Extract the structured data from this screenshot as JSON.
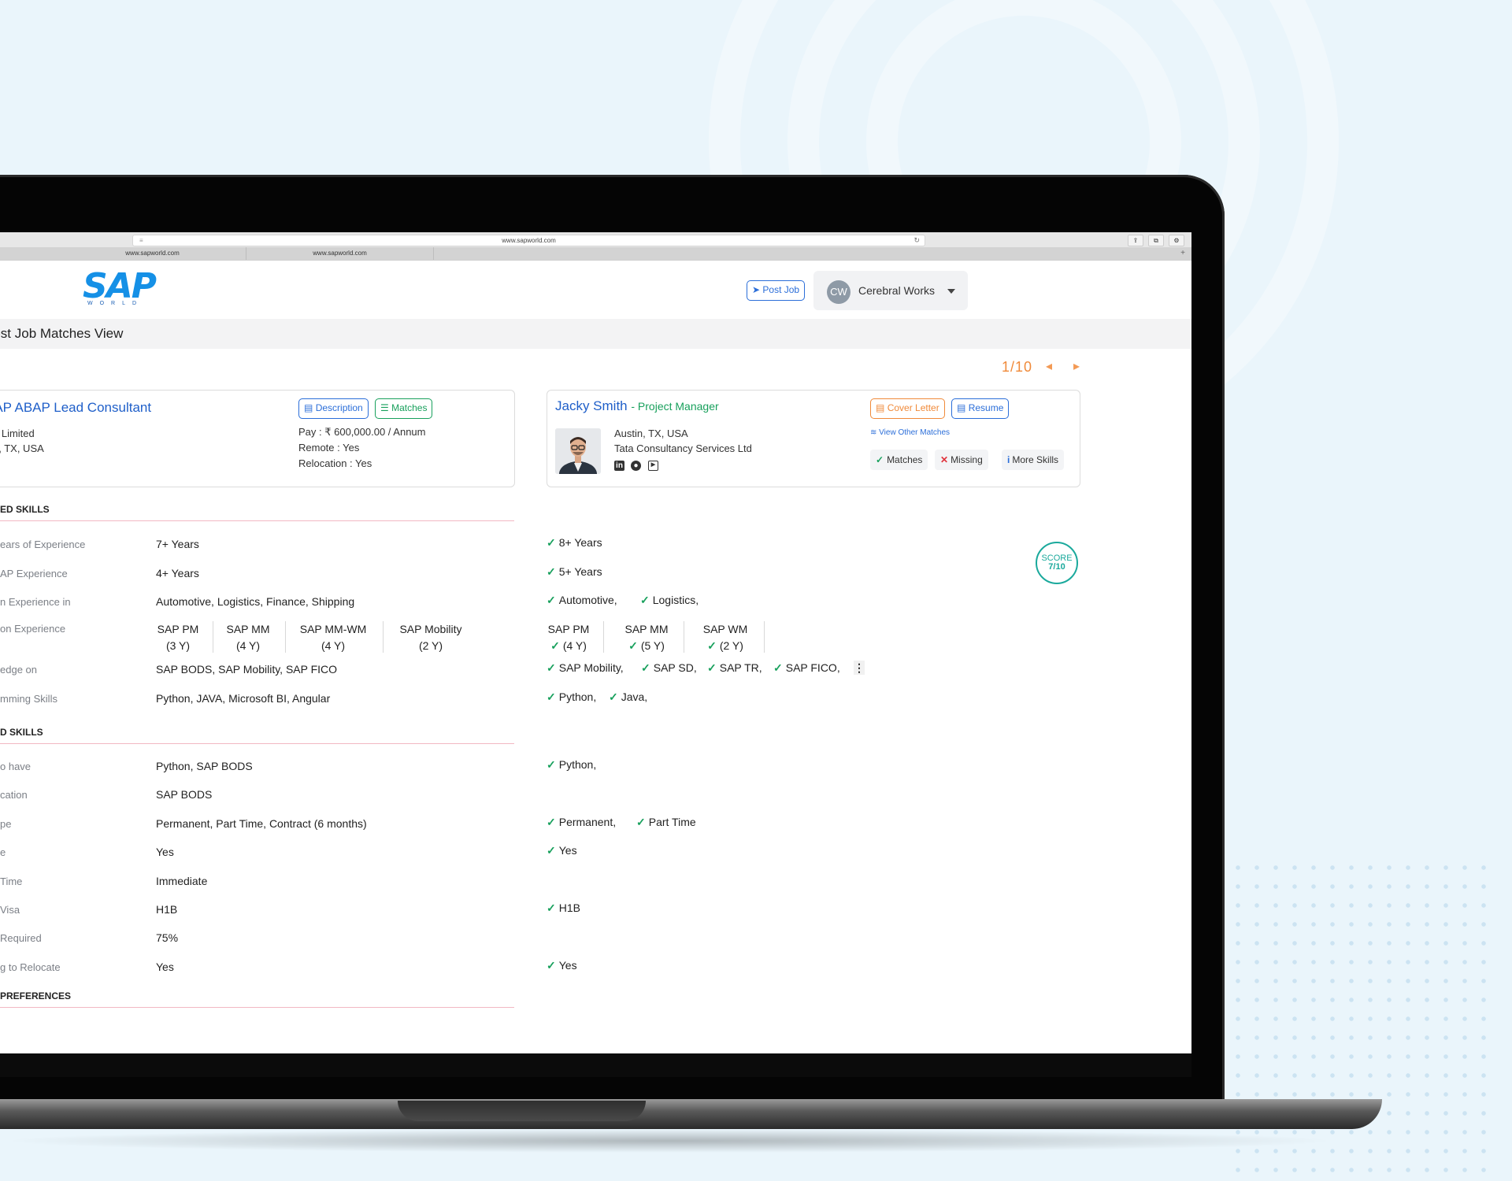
{
  "browser": {
    "url": "www.sapworld.com",
    "tabs": [
      "www.sapworld.com",
      "www.sapworld.com"
    ]
  },
  "header": {
    "logo_text": "SAP",
    "logo_sub": "WORLD",
    "post_job": "Post Job",
    "account_initials": "CW",
    "account_name": "Cerebral Works"
  },
  "page": {
    "title": "Post Job Matches View",
    "pager": "1/10"
  },
  "job": {
    "title": "SAP ABAP Lead Consultant",
    "company": "o Limited",
    "location": "n, TX, USA",
    "description_btn": "Description",
    "matches_btn": "Matches",
    "pay": "Pay : ₹ 600,000.00 / Annum",
    "remote": "Remote : Yes",
    "relocation": "Relocation : Yes"
  },
  "candidate": {
    "name": "Jacky Smith",
    "role": "- Project Manager",
    "location": "Austin, TX, USA",
    "company": "Tata Consultancy Services Ltd",
    "cover_letter_btn": "Cover Letter",
    "resume_btn": "Resume",
    "view_other": "View Other Matches",
    "chips": [
      "Matches",
      "Missing",
      "More Skills"
    ]
  },
  "score": {
    "label": "SCORE",
    "value": "7/10"
  },
  "sections": {
    "required": "ED SKILLS",
    "desired": "D SKILLS",
    "preferences": "PREFERENCES"
  },
  "required_rows": [
    {
      "label": "ears of Experience",
      "value": "7+ Years",
      "match": [
        "8+ Years"
      ]
    },
    {
      "label": "AP Experience",
      "value": "4+ Years",
      "match": [
        "5+ Years"
      ]
    },
    {
      "label": "n Experience in",
      "value": "Automotive, Logistics, Finance, Shipping",
      "match": [
        "Automotive,",
        "Logistics,"
      ]
    },
    {
      "label": "on Experience",
      "value": "",
      "match": []
    },
    {
      "label": "edge on",
      "value": "SAP BODS, SAP Mobility, SAP FICO",
      "match": [
        "SAP Mobility,",
        "SAP SD,",
        "SAP TR,",
        "SAP FICO,"
      ]
    },
    {
      "label": "mming Skills",
      "value": "Python, JAVA, Microsoft BI, Angular",
      "match": [
        "Python,",
        "Java,"
      ]
    }
  ],
  "modules_required": [
    {
      "name": "SAP PM",
      "years": "(3 Y)"
    },
    {
      "name": "SAP MM",
      "years": "(4 Y)"
    },
    {
      "name": "SAP MM-WM",
      "years": "(4 Y)"
    },
    {
      "name": "SAP Mobility",
      "years": "(2 Y)"
    }
  ],
  "modules_candidate": [
    {
      "name": "SAP PM",
      "years": "(4 Y)"
    },
    {
      "name": "SAP MM",
      "years": "(5 Y)"
    },
    {
      "name": "SAP WM",
      "years": "(2 Y)"
    }
  ],
  "desired_rows": [
    {
      "label": "o have",
      "value": "Python, SAP BODS",
      "match": [
        "Python,"
      ]
    },
    {
      "label": "cation",
      "value": "SAP BODS",
      "match": []
    },
    {
      "label": "pe",
      "value": "Permanent, Part Time, Contract (6 months)",
      "match": [
        "Permanent,",
        "Part Time"
      ]
    },
    {
      "label": "e",
      "value": "Yes",
      "match": [
        "Yes"
      ]
    },
    {
      "label": "Time",
      "value": "Immediate",
      "match": []
    },
    {
      "label": "Visa",
      "value": "H1B",
      "match": [
        "H1B"
      ]
    },
    {
      "label": "Required",
      "value": "75%",
      "match": []
    },
    {
      "label": "g to Relocate",
      "value": "Yes",
      "match": [
        "Yes"
      ]
    }
  ],
  "colors": {
    "brand": "#1590e6",
    "accent_orange": "#f08a3a",
    "match_green": "#17a05c",
    "score_teal": "#1aa99c"
  }
}
